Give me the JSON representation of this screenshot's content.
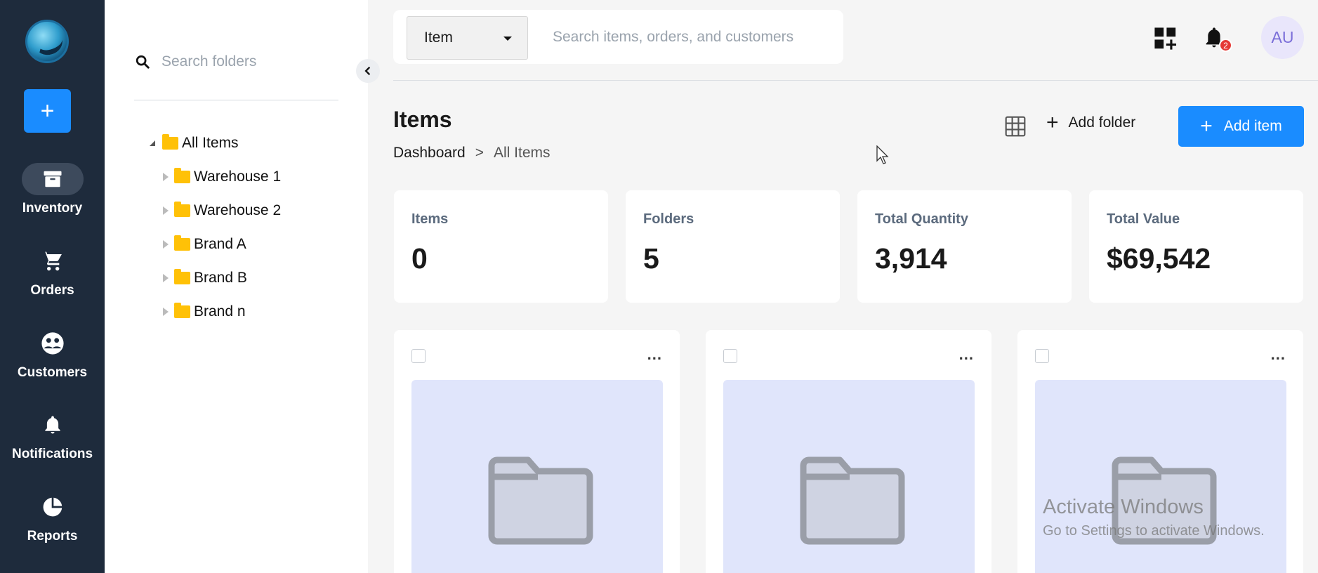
{
  "nav": {
    "add_label": "+",
    "items": [
      {
        "label": "Inventory",
        "icon": "archive-icon"
      },
      {
        "label": "Orders",
        "icon": "cart-icon"
      },
      {
        "label": "Customers",
        "icon": "customers-icon"
      },
      {
        "label": "Notifications",
        "icon": "bell-icon"
      },
      {
        "label": "Reports",
        "icon": "pie-chart-icon"
      }
    ]
  },
  "folders": {
    "search_placeholder": "Search folders",
    "tree": [
      {
        "label": "All Items",
        "expanded": true
      },
      {
        "label": "Warehouse 1"
      },
      {
        "label": "Warehouse 2"
      },
      {
        "label": "Brand A"
      },
      {
        "label": "Brand B"
      },
      {
        "label": "Brand n"
      }
    ]
  },
  "topbar": {
    "select_value": "Item",
    "search_placeholder": "Search items, orders, and  customers",
    "notification_count": "2",
    "avatar_initials": "AU"
  },
  "page": {
    "title": "Items",
    "breadcrumb": [
      "Dashboard",
      ">",
      "All Items"
    ],
    "add_folder_label": "Add folder",
    "add_item_label": "Add item",
    "accent_color": "#1a8cff"
  },
  "stats": [
    {
      "label": "Items",
      "value": "0"
    },
    {
      "label": "Folders",
      "value": "5"
    },
    {
      "label": "Total Quantity",
      "value": "3,914"
    },
    {
      "label": "Total Value",
      "value": "$69,542"
    }
  ],
  "cards": [
    {
      "menu": "..."
    },
    {
      "menu": "..."
    },
    {
      "menu": "..."
    }
  ],
  "watermark": {
    "title": "Activate Windows",
    "subtitle": "Go to Settings to activate Windows."
  }
}
